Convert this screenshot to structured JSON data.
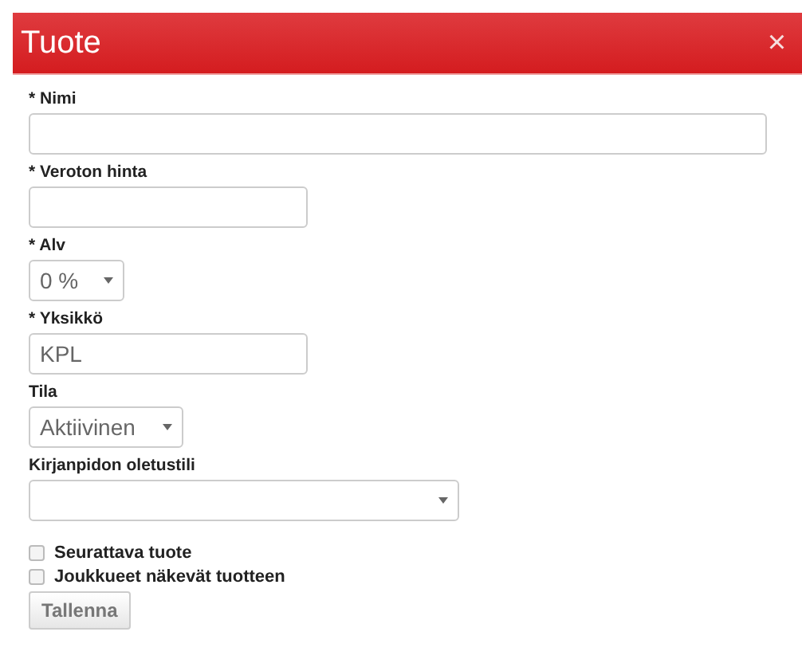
{
  "dialog": {
    "title": "Tuote",
    "close": "×"
  },
  "fields": [
    {
      "kind": "text",
      "label": "* Nimi"
    },
    {
      "kind": "text",
      "label": "* Veroton hinta"
    },
    {
      "kind": "select",
      "label": "* Alv",
      "value": "0 %"
    },
    {
      "kind": "text",
      "label": "* Yksikkö",
      "value": "KPL"
    },
    {
      "kind": "select",
      "label": "Tila",
      "value": "Aktiivinen"
    },
    {
      "kind": "select",
      "label": "Kirjanpidon oletustili"
    }
  ],
  "checkboxes": [
    {
      "label": "Seurattava tuote",
      "checked": false
    },
    {
      "label": "Joukkueet näkevät tuotteen",
      "checked": false
    }
  ],
  "save_button": "Tallenna"
}
